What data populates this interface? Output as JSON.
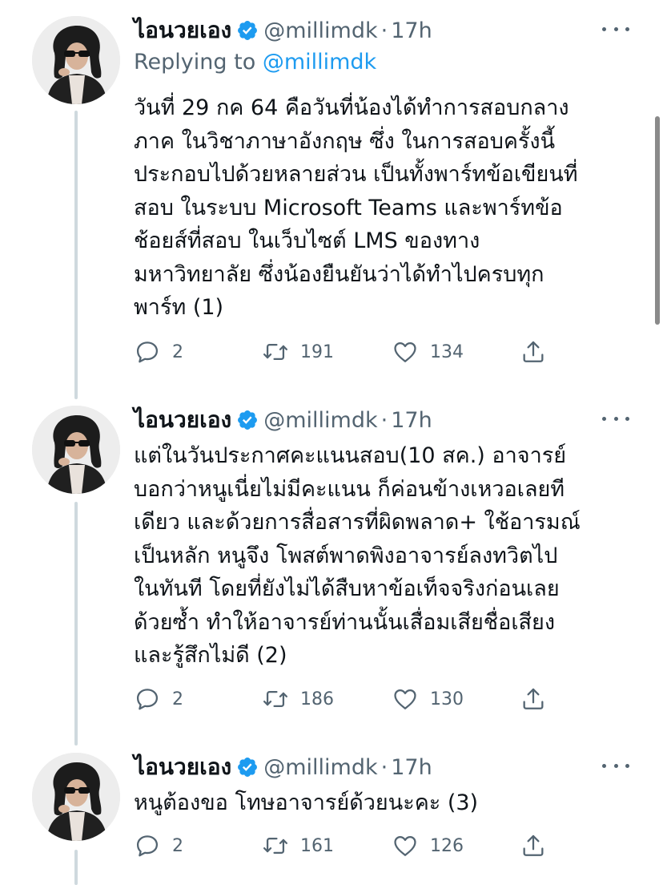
{
  "tweets": [
    {
      "name": "ไอนวยเอง",
      "handle": "@millimdk",
      "separator": "·",
      "time": "17h",
      "replying_prefix": "Replying to",
      "replying_mention": "@millimdk",
      "lines": [
        "วันที่ 29 กค 64 คือวันที่น้องได้ทำการสอบกลาง",
        "ภาค ในวิชาภาษาอังกฤษ ซึ่ง ในการสอบครั้งนี้",
        "ประกอบไปด้วยหลายส่วน เป็นทั้งพาร์ทข้อเขียนที่",
        "สอบ ในระบบ Microsoft Teams และพาร์ทข้อ",
        "ช้อยส์ที่สอบ ในเว็บไซต์ LMS ของทาง",
        "มหาวิทยาลัย ซึ่งน้องยืนยันว่าได้ทำไปครบทุก",
        "พาร์ท (1)"
      ],
      "replies": "2",
      "retweets": "191",
      "likes": "134"
    },
    {
      "name": "ไอนวยเอง",
      "handle": "@millimdk",
      "separator": "·",
      "time": "17h",
      "lines": [
        "แต่ในวันประกาศคะแนนสอบ(10 สค.) อาจารย์",
        "บอกว่าหนูเนี่ยไม่มีคะแนน ก็ค่อนข้างเหวอเลยที",
        "เดียว และด้วยการสื่อสารที่ผิดพลาด+ ใช้อารมณ์",
        "เป็นหลัก หนูจึง โพสต์พาดพิงอาจารย์ลงทวิตไป",
        "ในทันที โดยที่ยังไม่ได้สืบหาข้อเท็จจริงก่อนเลย",
        "ด้วยซ้ำ ทำให้อาจารย์ท่านนั้นเสื่อมเสียชื่อเสียง",
        "และรู้สึกไม่ดี (2)"
      ],
      "replies": "2",
      "retweets": "186",
      "likes": "130"
    },
    {
      "name": "ไอนวยเอง",
      "handle": "@millimdk",
      "separator": "·",
      "time": "17h",
      "lines": [
        "หนูต้องขอ โทษอาจารย์ด้วยนะคะ (3)"
      ],
      "replies": "2",
      "retweets": "161",
      "likes": "126"
    }
  ],
  "icons": {
    "verified": "verified-badge-icon",
    "more": "more-options-icon",
    "reply": "reply-icon",
    "retweet": "retweet-icon",
    "like": "like-icon",
    "share": "share-icon"
  },
  "colors": {
    "text": "#0f1419",
    "secondary": "#536471",
    "accent": "#1d9bf0",
    "thread_line": "#cfd9de"
  }
}
